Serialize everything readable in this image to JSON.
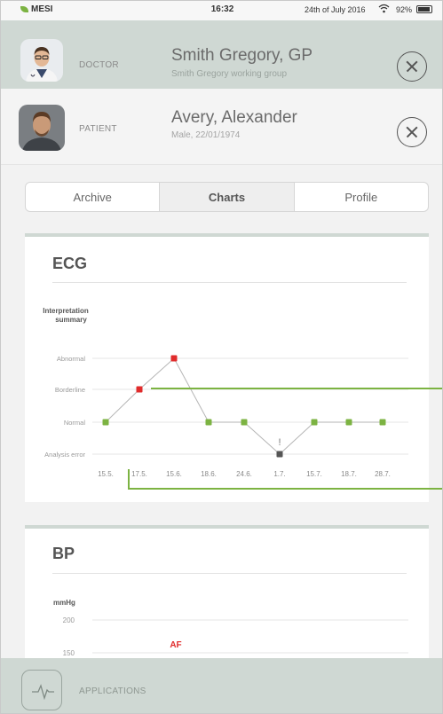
{
  "status_bar": {
    "carrier": "MESI",
    "time": "16:32",
    "date": "24th of July 2016",
    "battery": "92%",
    "battery_level": 0.92
  },
  "doctor": {
    "role_label": "DOCTOR",
    "name": "Smith Gregory, GP",
    "group": "Smith Gregory working group"
  },
  "patient": {
    "role_label": "PATIENT",
    "name": "Avery, Alexander",
    "details": "Male, 22/01/1974"
  },
  "tabs": [
    {
      "label": "Archive",
      "active": false
    },
    {
      "label": "Charts",
      "active": true
    },
    {
      "label": "Profile",
      "active": false
    }
  ],
  "ecg_card": {
    "title": "ECG"
  },
  "bp_card": {
    "title": "BP"
  },
  "bottom_bar": {
    "label": "APPLICATIONS",
    "icon": "ecg-waveform-icon"
  },
  "colors": {
    "accent_green": "#7cb342",
    "alert_red": "#e02b2b",
    "error_gray": "#555555",
    "header_bg": "#cfd8d3"
  },
  "chart_data": [
    {
      "type": "line",
      "title": "ECG",
      "ylabel": "Interpretation summary",
      "y_categories": [
        "Analysis error",
        "Normal",
        "Borderline",
        "Abnormal"
      ],
      "x": [
        "15.5.",
        "17.5.",
        "15.6.",
        "18.6.",
        "24.6.",
        "1.7.",
        "15.7.",
        "18.7.",
        "28.7."
      ],
      "points": [
        {
          "x": 0,
          "y": "Normal",
          "status": "normal"
        },
        {
          "x": 1,
          "y": "Borderline",
          "status": "alert"
        },
        {
          "x": 2,
          "y": "Abnormal",
          "status": "alert"
        },
        {
          "x": 3,
          "y": "Normal",
          "status": "normal"
        },
        {
          "x": 4,
          "y": "Normal",
          "status": "normal"
        },
        {
          "x": 5,
          "y": "Analysis error",
          "status": "error"
        },
        {
          "x": 6,
          "y": "Normal",
          "status": "normal"
        },
        {
          "x": 7,
          "y": "Normal",
          "status": "normal"
        },
        {
          "x": 8,
          "y": "Normal",
          "status": "normal"
        }
      ],
      "error_marker": "!",
      "grid": true
    },
    {
      "type": "line",
      "title": "BP",
      "ylabel": "mmHg",
      "yticks": [
        200,
        150
      ],
      "annotations": [
        "AF"
      ],
      "grid": true
    }
  ]
}
